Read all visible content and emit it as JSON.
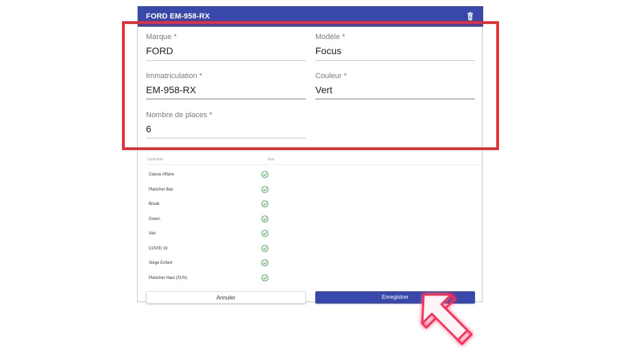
{
  "header": {
    "title": "FORD EM-958-RX",
    "delete_icon": "trash-icon"
  },
  "form": {
    "marque": {
      "label": "Marque *",
      "value": "FORD"
    },
    "modele": {
      "label": "Modèle *",
      "value": "Focus"
    },
    "immatriculation": {
      "label": "Immatriculation *",
      "value": "EM-958-RX"
    },
    "couleur": {
      "label": "Couleur *",
      "value": "Vert"
    },
    "places": {
      "label": "Nombre de places *",
      "value": "6"
    }
  },
  "list": {
    "col_contrainte": "Contrainte",
    "col_etat": "Etat",
    "items": [
      {
        "name": "Classe Affaire",
        "status": "check-circle-icon"
      },
      {
        "name": "Plancher Bas",
        "status": "check-circle-icon"
      },
      {
        "name": "Break",
        "status": "check-circle-icon"
      },
      {
        "name": "Green",
        "status": "check-circle-icon"
      },
      {
        "name": "Van",
        "status": "check-circle-icon"
      },
      {
        "name": "COVID 19",
        "status": "check-circle-icon"
      },
      {
        "name": "Siège Enfant",
        "status": "check-circle-icon"
      },
      {
        "name": "Plancher Haut (SUV)",
        "status": "check-circle-icon"
      }
    ]
  },
  "buttons": {
    "cancel": "Annuler",
    "save": "Enregistrer"
  },
  "colors": {
    "primary": "#3949ab",
    "highlight": "#ef2b2f",
    "check": "#2e9c3f",
    "cursor": "#ff2a55"
  }
}
